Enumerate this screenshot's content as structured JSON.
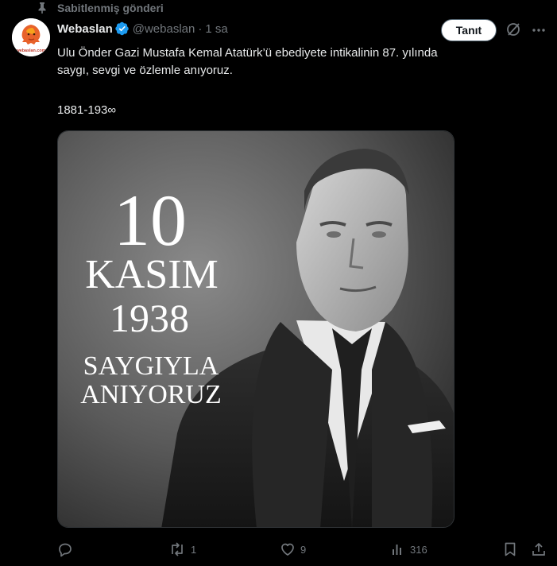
{
  "pinned": {
    "label": "Sabitlenmiş gönderi"
  },
  "author": {
    "name": "Webaslan",
    "handle": "@webaslan",
    "separator": "·",
    "time": "1 sa",
    "avatar_text": "webaslan.com"
  },
  "follow_button": {
    "label": "Tanıt"
  },
  "tweet": {
    "text": "Ulu Önder Gazi Mustafa Kemal Atatürk’ü ebediyete intikalinin 87. yılında\nsaygı, sevgi ve özlemle anıyoruz.",
    "years": "1881-193∞"
  },
  "media": {
    "day": "10",
    "month": "KASIM",
    "year": "1938",
    "line1": "SAYGIYLA",
    "line2": "ANIYORUZ"
  },
  "stats": {
    "replies": "",
    "reposts": "1",
    "likes": "9",
    "views": "316"
  },
  "colors": {
    "background": "#000000",
    "text": "#e7e9ea",
    "muted": "#71767b",
    "verified": "#1d9bf0"
  }
}
